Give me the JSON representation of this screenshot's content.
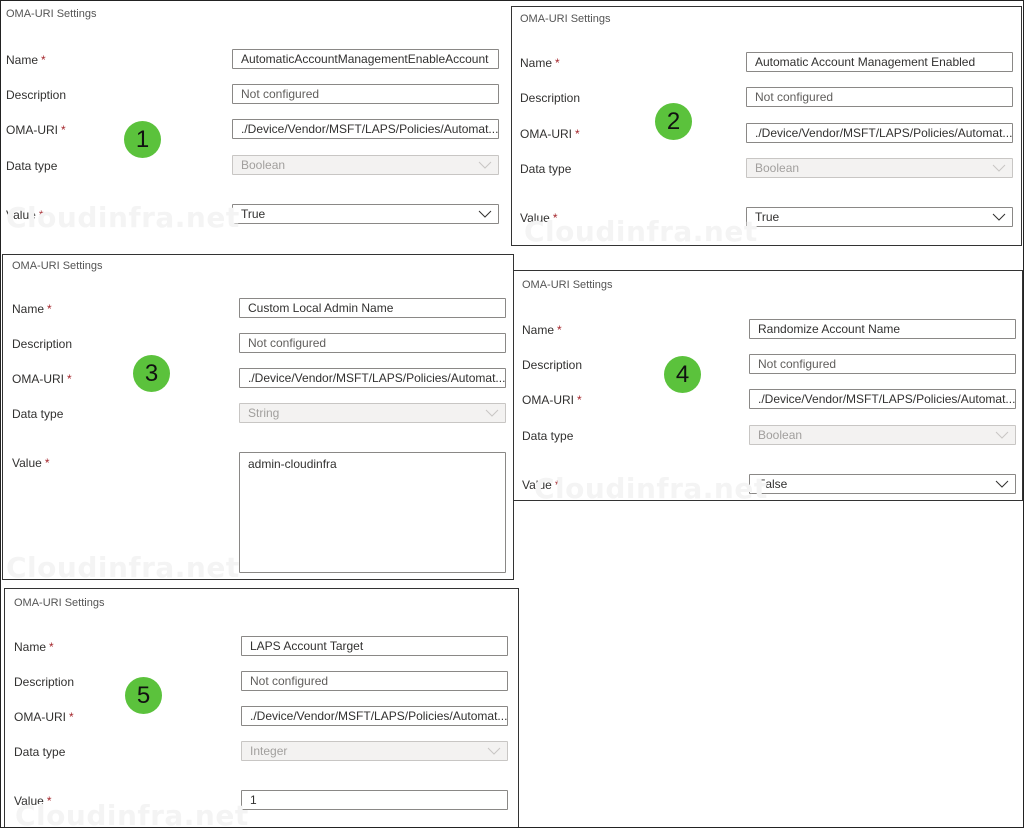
{
  "watermark": "Cloudinfra.net",
  "labels": {
    "section_title": "OMA-URI Settings",
    "name": "Name",
    "description": "Description",
    "oma_uri": "OMA-URI",
    "data_type": "Data type",
    "value": "Value",
    "required_marker": "*"
  },
  "panels": [
    {
      "badge": "1",
      "name": "AutomaticAccountManagementEnableAccount",
      "description_placeholder": "Not configured",
      "oma_uri": "./Device/Vendor/MSFT/LAPS/Policies/Automat...",
      "data_type": "Boolean",
      "value": "True",
      "value_kind": "dropdown"
    },
    {
      "badge": "2",
      "name": "Automatic Account Management Enabled",
      "description_placeholder": "Not configured",
      "oma_uri": "./Device/Vendor/MSFT/LAPS/Policies/Automat...",
      "data_type": "Boolean",
      "value": "True",
      "value_kind": "dropdown"
    },
    {
      "badge": "3",
      "name": "Custom Local Admin Name",
      "description_placeholder": "Not configured",
      "oma_uri": "./Device/Vendor/MSFT/LAPS/Policies/Automat...",
      "data_type": "String",
      "value": "admin-cloudinfra",
      "value_kind": "textarea"
    },
    {
      "badge": "4",
      "name": "Randomize Account Name",
      "description_placeholder": "Not configured",
      "oma_uri": "./Device/Vendor/MSFT/LAPS/Policies/Automat...",
      "data_type": "Boolean",
      "value": "False",
      "value_kind": "dropdown"
    },
    {
      "badge": "5",
      "name": "LAPS Account Target",
      "description_placeholder": "Not configured",
      "oma_uri": "./Device/Vendor/MSFT/LAPS/Policies/Automat...",
      "data_type": "Integer",
      "value": "1",
      "value_kind": "text"
    }
  ],
  "colors": {
    "badge": "#5bc23c",
    "required": "#a4262c"
  }
}
